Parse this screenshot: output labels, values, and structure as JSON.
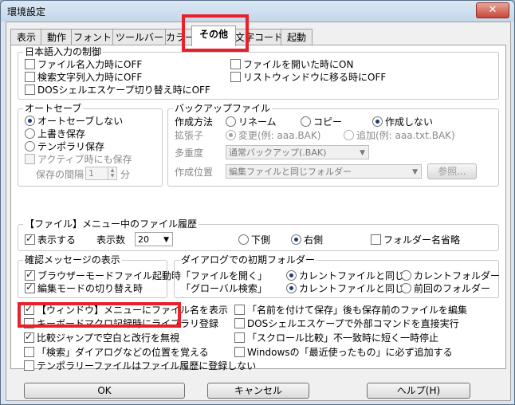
{
  "window": {
    "title": "環境設定",
    "close_glyph": "✕"
  },
  "tabs": [
    "表示",
    "動作",
    "フォント",
    "ツールバー",
    "カラー",
    "その他",
    "文字コード",
    "起動"
  ],
  "active_tab": "その他",
  "jp_input": {
    "title": "日本語入力の制御",
    "left": [
      {
        "label": "ファイル名入力時にOFF",
        "checked": false
      },
      {
        "label": "検索文字列入力時にOFF",
        "checked": false
      },
      {
        "label": "DOSシェルエスケープ切り替え時にOFF",
        "checked": false
      }
    ],
    "right": [
      {
        "label": "ファイルを開いた時にON",
        "checked": false
      },
      {
        "label": "リストウィンドウに移る時にOFF",
        "checked": false
      }
    ]
  },
  "autosave": {
    "title": "オートセーブ",
    "options": [
      {
        "label": "オートセーブしない",
        "checked": true
      },
      {
        "label": "上書き保存",
        "checked": false
      },
      {
        "label": "テンポラリ保存",
        "checked": false
      }
    ],
    "active_save": "アクティブ時にも保存",
    "interval_label": "保存の間隔",
    "interval_value": "1",
    "interval_unit": "分"
  },
  "backup": {
    "title": "バックアップファイル",
    "method_label": "作成方法",
    "methods": [
      {
        "label": "リネーム",
        "checked": false
      },
      {
        "label": "コピー",
        "checked": false
      },
      {
        "label": "作成しない",
        "checked": true
      }
    ],
    "ext_label": "拡張子",
    "exts": [
      {
        "label": "変更(例: aaa.BAK)",
        "checked": true
      },
      {
        "label": "追加(例: aaa.txt.BAK)",
        "checked": false
      }
    ],
    "multi_label": "多重度",
    "multi_value": "通常バックアップ(.BAK)",
    "location_label": "作成位置",
    "location_value": "編集ファイルと同じフォルダー",
    "browse_label": "参照..."
  },
  "history": {
    "title": "【ファイル】メニュー中のファイル履歴",
    "show_label": "表示する",
    "show_checked": true,
    "count_label": "表示数",
    "count_value": "20",
    "positions": [
      {
        "label": "下側",
        "checked": false
      },
      {
        "label": "右側",
        "checked": true
      }
    ],
    "omit_label": "フォルダー名省略",
    "omit_checked": false
  },
  "confirm": {
    "title": "確認メッセージの表示",
    "items": [
      {
        "label": "ブラウザーモードファイル起動時",
        "checked": true
      },
      {
        "label": "編集モードの切り替え時",
        "checked": true
      }
    ]
  },
  "dialog_folder": {
    "title": "ダイアログでの初期フォルダー",
    "rows": [
      {
        "label": "「ファイルを開く」",
        "opt1": "カレントファイルと同じ",
        "opt1_checked": true,
        "opt2": "カレントフォルダー",
        "opt2_checked": false
      },
      {
        "label": "「グローバル検索」",
        "opt1": "カレントファイルと同じ",
        "opt1_checked": true,
        "opt2": "前回のフォルダー",
        "opt2_checked": false
      }
    ]
  },
  "misc_left": [
    {
      "label": "【ウィンドウ】メニューにファイル名を表示",
      "checked": true
    },
    {
      "label": "キーボードマクロ記録時にライブラリ登録",
      "checked": false
    },
    {
      "label": "比較ジャンプで空白と改行を無視",
      "checked": true
    },
    {
      "label": "「検索」ダイアログなどの位置を覚える",
      "checked": false
    },
    {
      "label": "テンポラリーファイルはファイル履歴に登録しない",
      "checked": false
    }
  ],
  "misc_right": [
    {
      "label": "「名前を付けて保存」後も保存前のファイルを編集",
      "checked": false
    },
    {
      "label": "DOSシェルエスケープで外部コマンドを直接実行",
      "checked": false
    },
    {
      "label": "「スクロール比較」不一致時に短く一時停止",
      "checked": false
    },
    {
      "label": "Windowsの「最近使ったもの」に必ず追加する",
      "checked": false
    }
  ],
  "buttons": {
    "ok": "OK",
    "cancel": "キャンセル",
    "help": "ヘルプ(H)"
  },
  "colors": {
    "highlight": "#e8202a"
  }
}
